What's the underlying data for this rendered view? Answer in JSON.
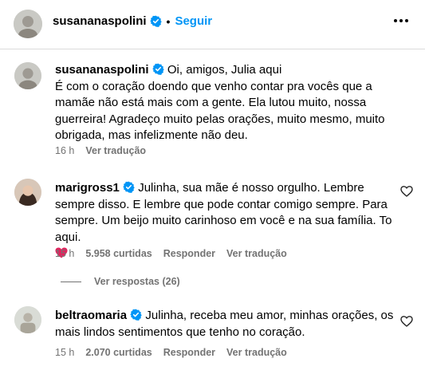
{
  "header": {
    "username": "susananaspolini",
    "separator": "•",
    "follow_label": "Seguir",
    "more_icon": "more-horizontal-icon"
  },
  "caption": {
    "username": "susananaspolini",
    "text": "Oi, amigos, Julia aqui\nÉ com o coração doendo que venho contar pra vocês que a mamãe não está mais com a gente. Ela lutou muito, nossa guerreira! Agradeço muito pelas orações, muito mesmo, muito obrigada, mas infelizmente não deu.",
    "time": "16 h",
    "translate_label": "Ver tradução"
  },
  "comments": [
    {
      "username": "marigross1",
      "text": "Julinha, sua mãe é nosso orgulho. Lembre sempre disso. E lembre que pode contar comigo sempre. Para sempre. Um beijo muito carinhoso em você e na sua família. To aqui.",
      "emoji": "red-heart",
      "time": "15 h",
      "likes": "5.958 curtidas",
      "reply_label": "Responder",
      "translate_label": "Ver tradução",
      "view_replies_label": "Ver respostas (26)"
    },
    {
      "username": "beltraomaria",
      "text": "Julinha, receba meu amor, minhas orações, os mais lindos sentimentos que tenho no coração.",
      "time": "15 h",
      "likes": "2.070 curtidas",
      "reply_label": "Responder",
      "translate_label": "Ver tradução"
    }
  ],
  "colors": {
    "link_blue": "#0095f6",
    "verified_blue": "#0095f6",
    "meta_gray": "#737373",
    "divider": "#dbdbdb",
    "heart_red": "#e0245e"
  }
}
